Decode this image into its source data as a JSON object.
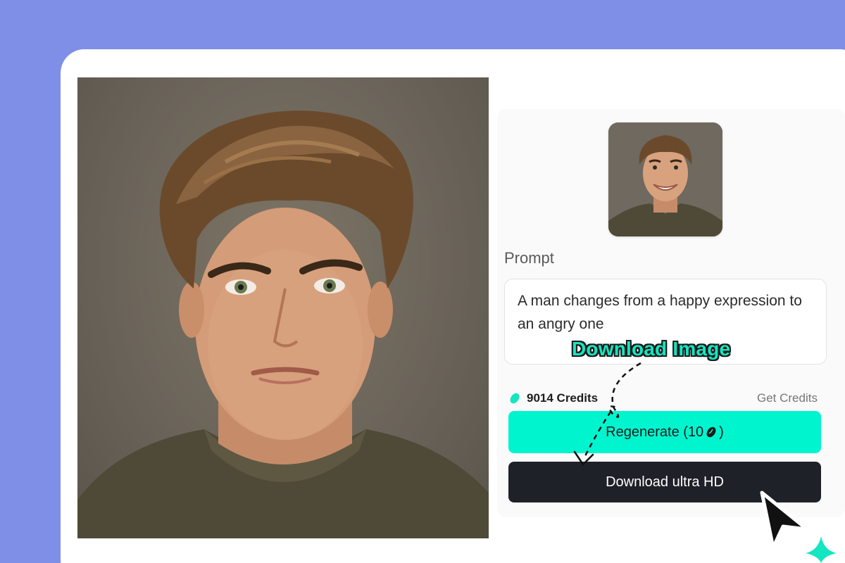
{
  "prompt": {
    "label": "Prompt",
    "text": "A man changes from a happy expression to an angry one"
  },
  "annotation": {
    "text": "Download Image"
  },
  "credits": {
    "amount_text": "9014 Credits",
    "get_credits_label": "Get Credits"
  },
  "buttons": {
    "regenerate_label": "Regenerate (10",
    "regenerate_suffix": ")",
    "download_label": "Download ultra HD"
  },
  "icons": {
    "credit": "bean-icon",
    "cursor": "cursor-pointer-icon",
    "sparkle": "sparkle-icon"
  },
  "colors": {
    "background": "#7f8fe8",
    "accent": "#00f5cf",
    "dark_button": "#1f2128",
    "annotation_text": "#14e6c1"
  }
}
